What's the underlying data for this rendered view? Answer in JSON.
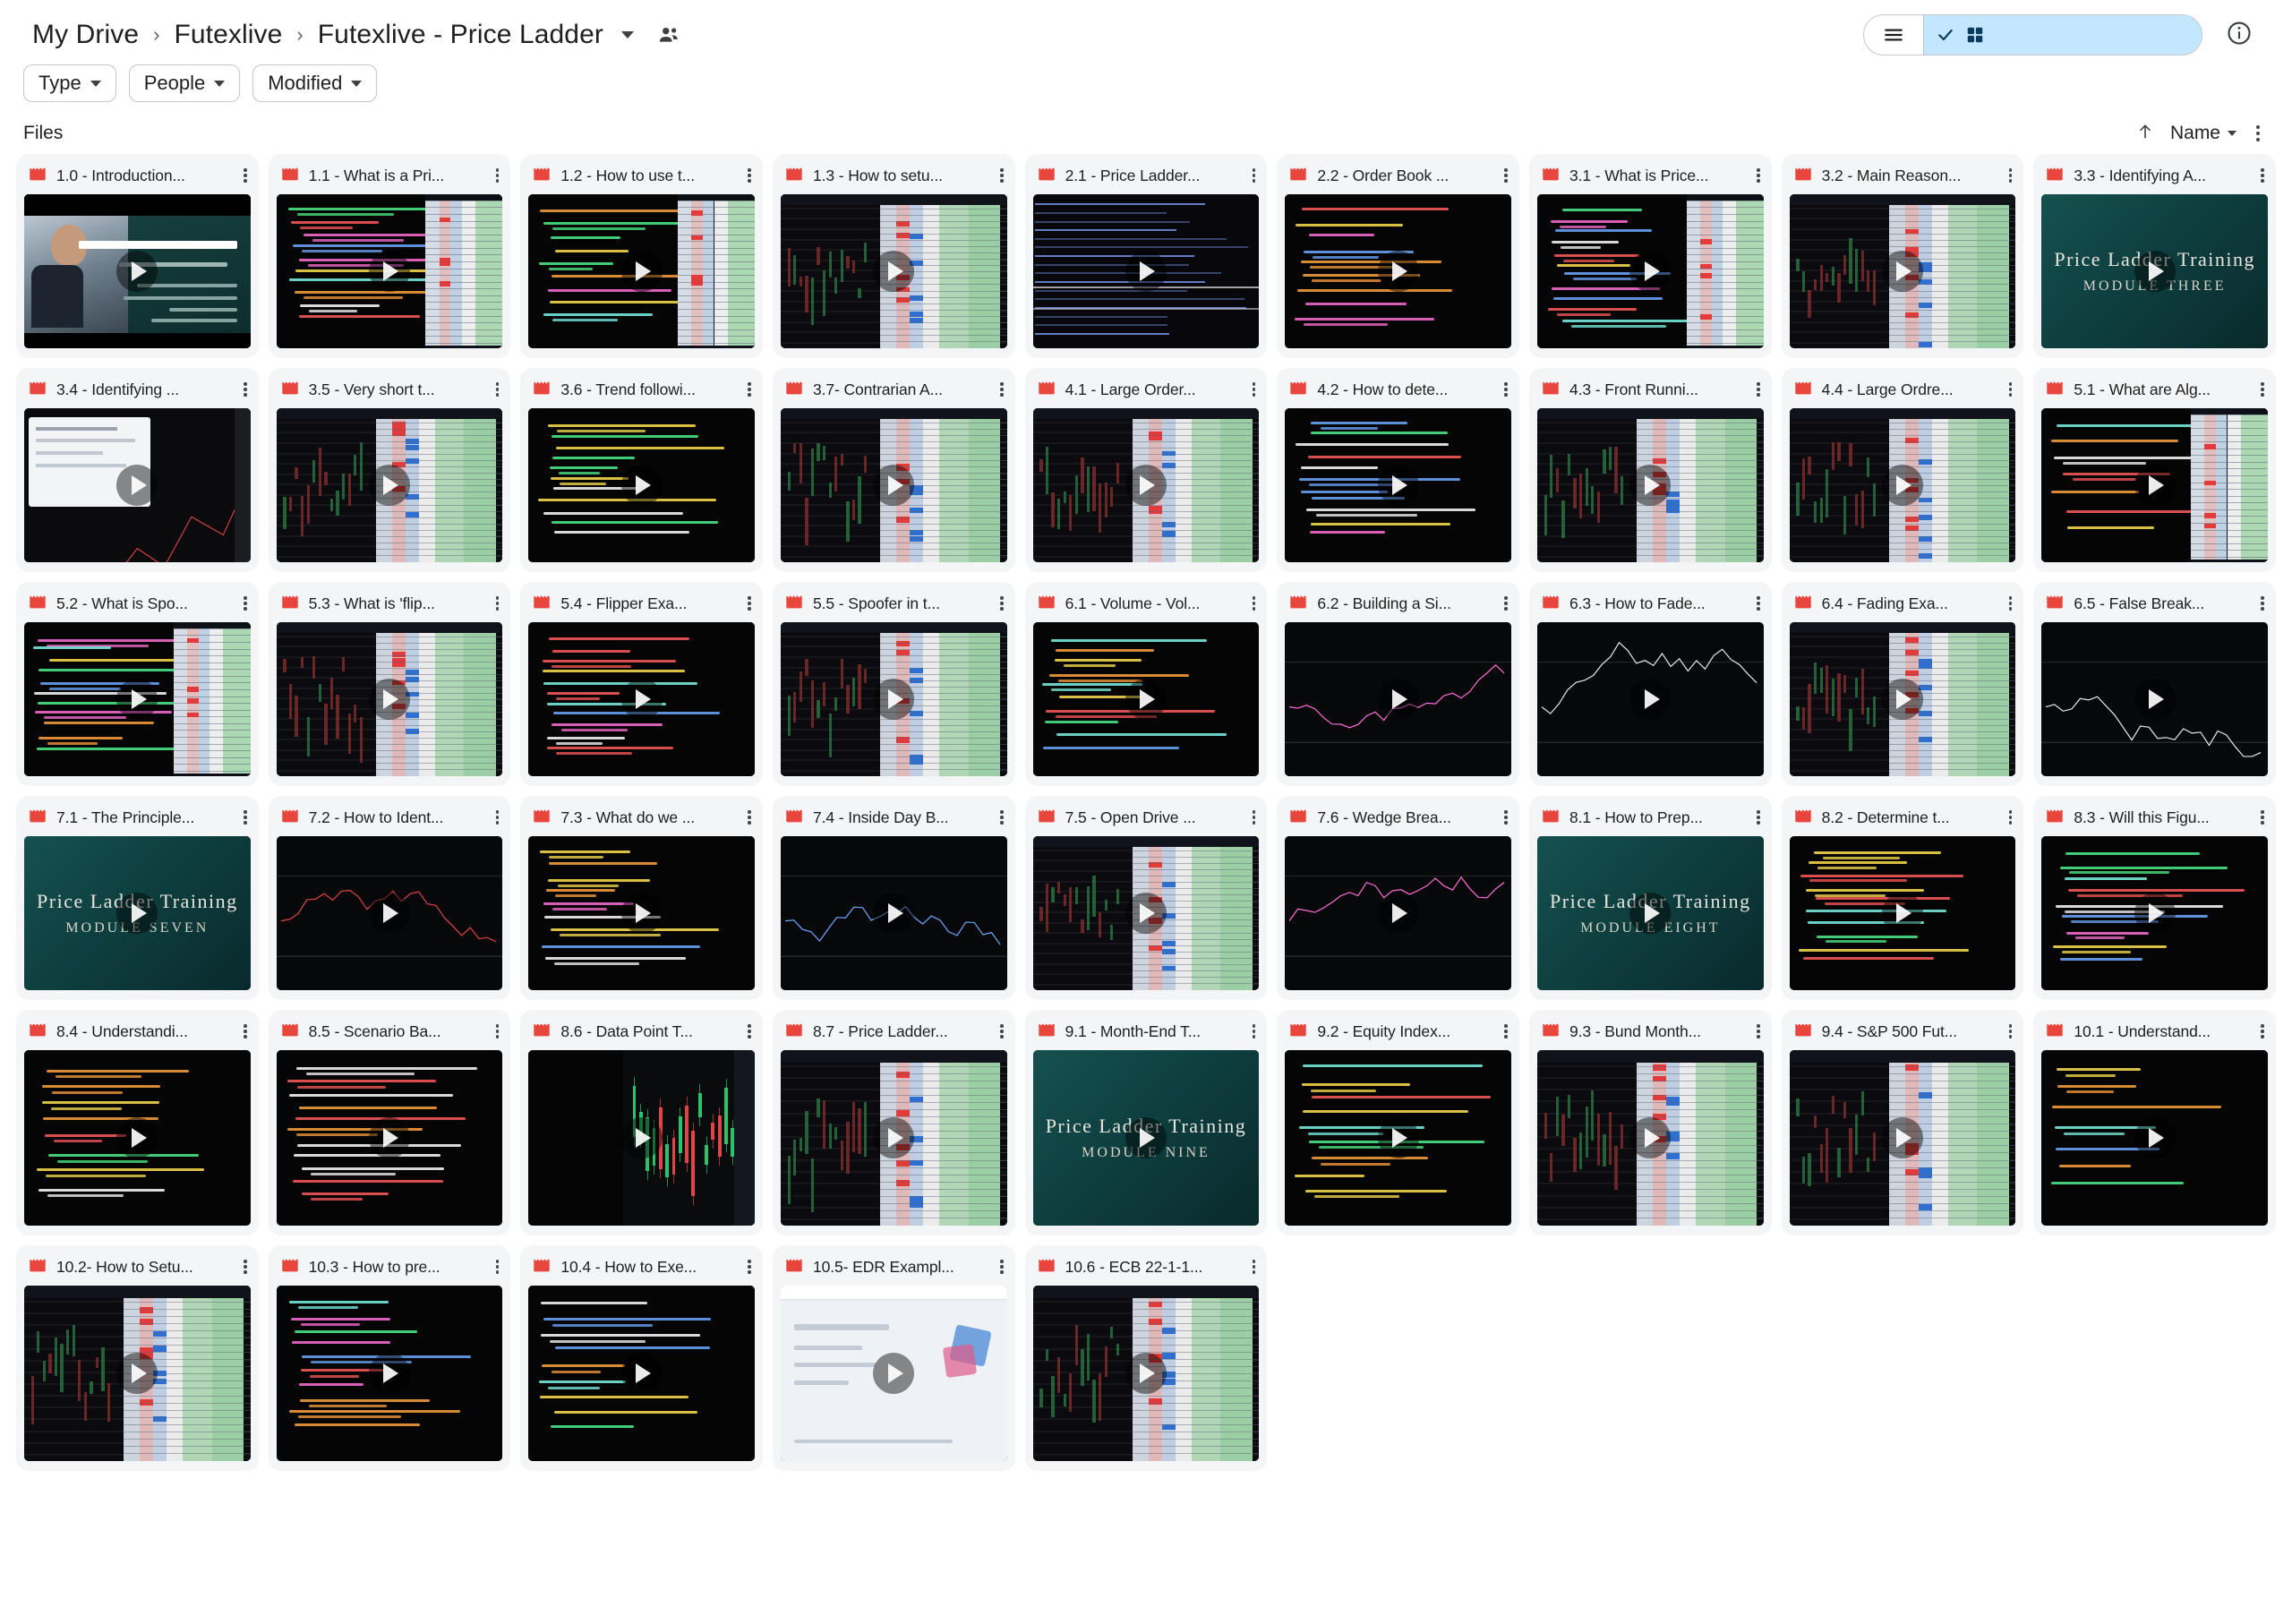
{
  "header": {
    "breadcrumb": [
      "My Drive",
      "Futexlive",
      "Futexlive - Price Ladder"
    ],
    "breadcrumb_separator": "›",
    "people_icon": "people-icon",
    "view_toggle": {
      "list_label": "list-view-icon",
      "grid_label": "grid-view-icon",
      "selected": "grid"
    },
    "info_icon": "info-icon"
  },
  "filters": [
    {
      "label": "Type",
      "name": "filter-type"
    },
    {
      "label": "People",
      "name": "filter-people"
    },
    {
      "label": "Modified",
      "name": "filter-modified"
    }
  ],
  "section": {
    "title": "Files",
    "sort_direction_icon": "arrow-up-icon",
    "sort_label": "Name",
    "more_icon": "more-options-icon"
  },
  "files": [
    {
      "title": "1.0 - Introduction...",
      "art": "person"
    },
    {
      "title": "1.1 - What is a Pri...",
      "art": "hand-ladder"
    },
    {
      "title": "1.2 - How to use t...",
      "art": "hand-ladder"
    },
    {
      "title": "1.3 - How to setu...",
      "art": "ladder"
    },
    {
      "title": "2.1 - Price Ladder...",
      "art": "lines"
    },
    {
      "title": "2.2 - Order Book ...",
      "art": "hand-dark"
    },
    {
      "title": "3.1 - What is Price...",
      "art": "hand-ladder"
    },
    {
      "title": "3.2 - Main Reason...",
      "art": "ladder"
    },
    {
      "title": "3.3 - Identifying A...",
      "art": "titlecard",
      "t1": "Price Ladder Training",
      "t2": "Module Three"
    },
    {
      "title": "3.4 - Identifying ...",
      "art": "slide-chart"
    },
    {
      "title": "3.5 - Very short t...",
      "art": "ladder"
    },
    {
      "title": "3.6 - Trend followi...",
      "art": "hand-green"
    },
    {
      "title": "3.7- Contrarian A...",
      "art": "ladder"
    },
    {
      "title": "4.1 - Large Order...",
      "art": "ladder"
    },
    {
      "title": "4.2 - How to dete...",
      "art": "hand-dark"
    },
    {
      "title": "4.3 - Front Runni...",
      "art": "ladder"
    },
    {
      "title": "4.4 - Large Ordre...",
      "art": "ladder"
    },
    {
      "title": "5.1 - What are Alg...",
      "art": "hand-ladder"
    },
    {
      "title": "5.2 - What is Spo...",
      "art": "hand-ladder"
    },
    {
      "title": "5.3 - What is 'flip...",
      "art": "ladder"
    },
    {
      "title": "5.4 - Flipper Exa...",
      "art": "hand-dark"
    },
    {
      "title": "5.5 - Spoofer in t...",
      "art": "ladder"
    },
    {
      "title": "6.1 - Volume - Vol...",
      "art": "hand-dark"
    },
    {
      "title": "6.2 - Building a Si...",
      "art": "chart-pink"
    },
    {
      "title": "6.3 - How to Fade...",
      "art": "chart-white"
    },
    {
      "title": "6.4 - Fading Exa...",
      "art": "ladder"
    },
    {
      "title": "6.5 - False Break...",
      "art": "chart-white"
    },
    {
      "title": "7.1 - The Principle...",
      "art": "titlecard",
      "t1": "Price Ladder Training",
      "t2": "Module Seven"
    },
    {
      "title": "7.2 - How to Ident...",
      "art": "chart-red"
    },
    {
      "title": "7.3 - What do we ...",
      "art": "hand-dark"
    },
    {
      "title": "7.4 - Inside Day B...",
      "art": "chart-blue"
    },
    {
      "title": "7.5 - Open Drive ...",
      "art": "ladder"
    },
    {
      "title": "7.6 - Wedge Brea...",
      "art": "chart-pink"
    },
    {
      "title": "8.1 - How to Prep...",
      "art": "titlecard",
      "t1": "Price Ladder Training",
      "t2": "Module Eight"
    },
    {
      "title": "8.2 - Determine t...",
      "art": "hand-dark"
    },
    {
      "title": "8.3 - Will this Figu...",
      "art": "hand-dark"
    },
    {
      "title": "8.4 - Understandi...",
      "art": "hand-dark",
      "tall": true
    },
    {
      "title": "8.5 - Scenario Ba...",
      "art": "hand-red",
      "tall": true
    },
    {
      "title": "8.6 - Data Point T...",
      "art": "chart-candles",
      "tall": true
    },
    {
      "title": "8.7 - Price Ladder...",
      "art": "ladder",
      "tall": true
    },
    {
      "title": "9.1 - Month-End T...",
      "art": "titlecard",
      "t1": "Price Ladder Training",
      "t2": "Module Nine",
      "tall": true
    },
    {
      "title": "9.2 - Equity Index...",
      "art": "hand-dark",
      "tall": true
    },
    {
      "title": "9.3 - Bund Month...",
      "art": "ladder",
      "tall": true
    },
    {
      "title": "9.4 - S&P 500 Fut...",
      "art": "ladder",
      "tall": true
    },
    {
      "title": "10.1 - Understand...",
      "art": "hand-dark",
      "tall": true
    },
    {
      "title": "10.2- How to Setu...",
      "art": "ladder",
      "tall": true
    },
    {
      "title": "10.3 - How to pre...",
      "art": "hand-dark",
      "tall": true
    },
    {
      "title": "10.4 - How to Exe...",
      "art": "hand-dark",
      "tall": true
    },
    {
      "title": "10.5- EDR Exampl...",
      "art": "slide-light",
      "tall": true
    },
    {
      "title": "10.6 - ECB 22-1-1...",
      "art": "ladder",
      "tall": true
    }
  ],
  "file_icon": "video-file-icon",
  "play_icon": "play-button-icon",
  "colors": {
    "accent": "#c2e7ff",
    "video_icon": "#e8453c",
    "card_bg": "#f4f5f7",
    "text": "#1f1f1f"
  }
}
